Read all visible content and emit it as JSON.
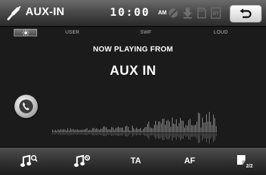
{
  "header": {
    "title": "AUX-IN",
    "clock": "10:00",
    "ampm": "AM",
    "status_icons": [
      "no-signal-icon",
      "download-icon",
      "sd-card-icon",
      "bluetooth-icon"
    ],
    "back_icon": "back-arrow-icon"
  },
  "sound_modes": {
    "brightness_icon": "sun-icon",
    "items": [
      "USER",
      "SWF",
      "LOUD"
    ]
  },
  "main": {
    "now_playing": "NOW PLAYING FROM",
    "source": "AUX IN",
    "phone_icon": "phone-icon"
  },
  "footer": {
    "buttons": [
      {
        "icon": "music-scan-icon"
      },
      {
        "icon": "music-random-icon"
      },
      {
        "label": "TA"
      },
      {
        "label": "AF"
      },
      {
        "icon": "page-icon"
      }
    ],
    "page": "2/2"
  },
  "colors": {
    "background": "#1b1b1b",
    "header_top": "#6b6b6b",
    "footer": "#323232",
    "text": "#ffffff"
  }
}
